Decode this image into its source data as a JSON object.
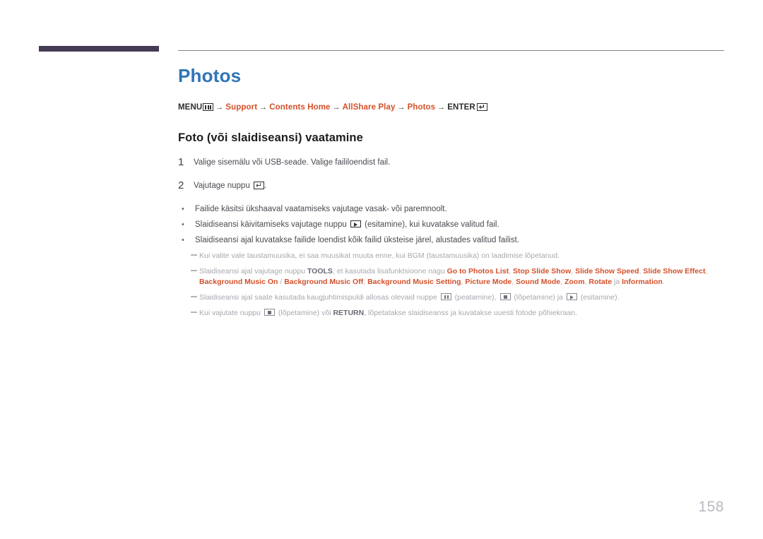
{
  "header": {
    "bar_color": "#453c54",
    "rule_color": "#808088"
  },
  "page_title": "Photos",
  "title_color": "#2e75b6",
  "breadcrumb": {
    "menu_label": "MENU",
    "menu_icon": "menu-icon",
    "items": [
      {
        "label": "Support",
        "style": "red"
      },
      {
        "label": "Contents Home",
        "style": "red"
      },
      {
        "label": "AllShare Play",
        "style": "red"
      },
      {
        "label": "Photos",
        "style": "red"
      }
    ],
    "arrow": "→",
    "enter_label": "ENTER",
    "enter_icon": "enter-icon",
    "accent_color": "#d4502a"
  },
  "section_heading": "Foto (või slaidiseansi) vaatamine",
  "steps": [
    {
      "number": "1",
      "text": "Valige sisemälu või USB-seade. Valige faililoendist fail."
    },
    {
      "number": "2",
      "text_before": "Vajutage nuppu ",
      "icon": "enter-icon",
      "text_after": "."
    }
  ],
  "bullets": [
    {
      "marker": "•",
      "text": "Failide käsitsi ükshaaval vaatamiseks vajutage vasak- või paremnoolt."
    },
    {
      "marker": "•",
      "text_before": "Slaidiseansi käivitamiseks vajutage nuppu ",
      "icon": "play-icon",
      "text_after": " (esitamine), kui kuvatakse valitud fail."
    },
    {
      "marker": "•",
      "text": "Slaidiseansi ajal kuvatakse failide loendist kõik failid üksteise järel, alustades valitud failist."
    }
  ],
  "notes": [
    {
      "id": "note-bgm",
      "text": "Kui valite vale taustamuusika, ei saa muusikat muuta enne, kui BGM (taustamuusika) on laadimise lõpetanud."
    },
    {
      "id": "note-tools",
      "lead": "Slaidiseansi ajal vajutage nuppu ",
      "tools_label": "TOOLS",
      "mid": ", et kasutada lisafunktsioone nagu ",
      "options": [
        "Go to Photos List",
        "Stop Slide Show",
        "Slide Show Speed",
        "Slide Show Effect",
        "Background Music On",
        "Background Music Off",
        "Background Music Setting",
        "Picture Mode",
        "Sound Mode",
        "Zoom",
        "Rotate",
        "Information"
      ],
      "slash": " / ",
      "conjunction": " ja ",
      "end": "."
    },
    {
      "id": "note-remote",
      "lead": "Slaidiseansi ajal saate kasutada kaugjuhtimispuldi allosas olevaid nuppe ",
      "pause_icon": "pause-icon",
      "pause_label": " (peatamine), ",
      "stop_icon": "stop-icon",
      "stop_label": " (lõpetamine) ja ",
      "play_icon": "play-icon",
      "play_label": " (esitamine)."
    },
    {
      "id": "note-return",
      "lead": "Kui vajutate nuppu ",
      "stop_icon": "stop-icon",
      "mid": " (lõpetamine) või ",
      "return_label": "RETURN",
      "end": ", lõpetatakse slaidiseanss ja kuvatakse uuesti fotode põhiekraan."
    }
  ],
  "page_number": "158"
}
